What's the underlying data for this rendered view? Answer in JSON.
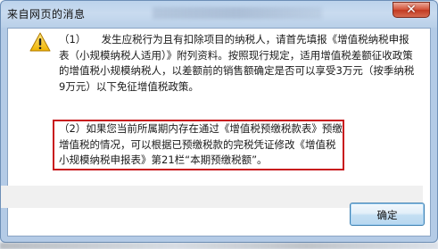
{
  "window": {
    "title": "来自网页的消息",
    "close_icon": "close-icon",
    "close_glyph": "✕"
  },
  "message": {
    "icon": "warning-icon",
    "paragraph1": "（1）　　发生应税行为且有扣除项目的纳税人，请首先填报《增值税纳税申报表（小规模纳税人适用）》附列资料。按照现行规定，适用增值税差额征收政策的增值税小规模纳税人，以差额前的销售额确定是否可以享受3万元（按季纳税9万元）以下免征增值税政策。",
    "paragraph2": "（2）如果您当前所属期内存在通过《增值税预缴税款表》预缴增值税的情况，可以根据已预缴税款的完税凭证修改《增值税小规模纳税申报表》第21栏“本期预缴税额”。"
  },
  "buttons": {
    "ok_label": "确定"
  },
  "colors": {
    "highlight_border": "#c8161d",
    "warning_yellow": "#f6c21a"
  }
}
